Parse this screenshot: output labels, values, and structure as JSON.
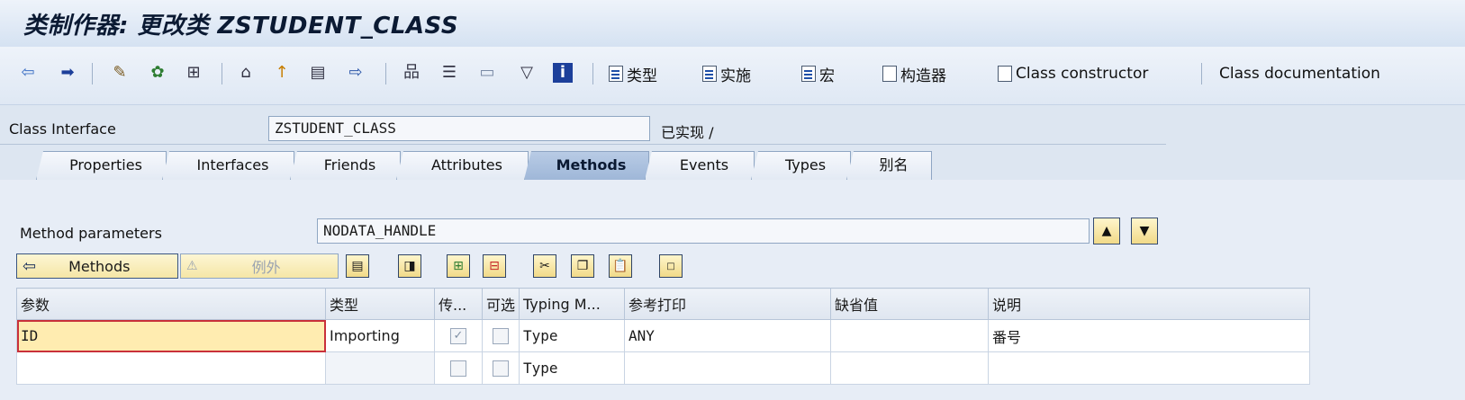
{
  "window": {
    "title": "类制作器: 更改类 ZSTUDENT_CLASS"
  },
  "toolbar": {
    "buttons": [
      {
        "label": "类型"
      },
      {
        "label": "实施"
      },
      {
        "label": "宏"
      },
      {
        "label": "构造器"
      },
      {
        "label": "Class constructor"
      },
      {
        "label": "Class documentation"
      }
    ]
  },
  "header": {
    "class_interface_label": "Class Interface",
    "class_interface_value": "ZSTUDENT_CLASS",
    "status": "已实现 /"
  },
  "tabs": [
    {
      "label": "Properties"
    },
    {
      "label": "Interfaces"
    },
    {
      "label": "Friends"
    },
    {
      "label": "Attributes"
    },
    {
      "label": "Methods",
      "active": true
    },
    {
      "label": "Events"
    },
    {
      "label": "Types"
    },
    {
      "label": "别名"
    }
  ],
  "method_params": {
    "label": "Method parameters",
    "value": "NODATA_HANDLE"
  },
  "subtoolbar": {
    "methods_label": "Methods",
    "exceptions_label": "例外"
  },
  "grid": {
    "columns": [
      "参数",
      "类型",
      "传...",
      "可选",
      "Typing M...",
      "参考打印",
      "缺省值",
      "说明"
    ],
    "rows": [
      {
        "param": "ID",
        "type": "Importing",
        "pass": true,
        "optional": false,
        "typing": "Type",
        "ref": "ANY",
        "default": "",
        "desc": "番号"
      },
      {
        "param": "",
        "type": "",
        "pass": false,
        "optional": false,
        "typing": "Type",
        "ref": "",
        "default": "",
        "desc": ""
      }
    ]
  }
}
